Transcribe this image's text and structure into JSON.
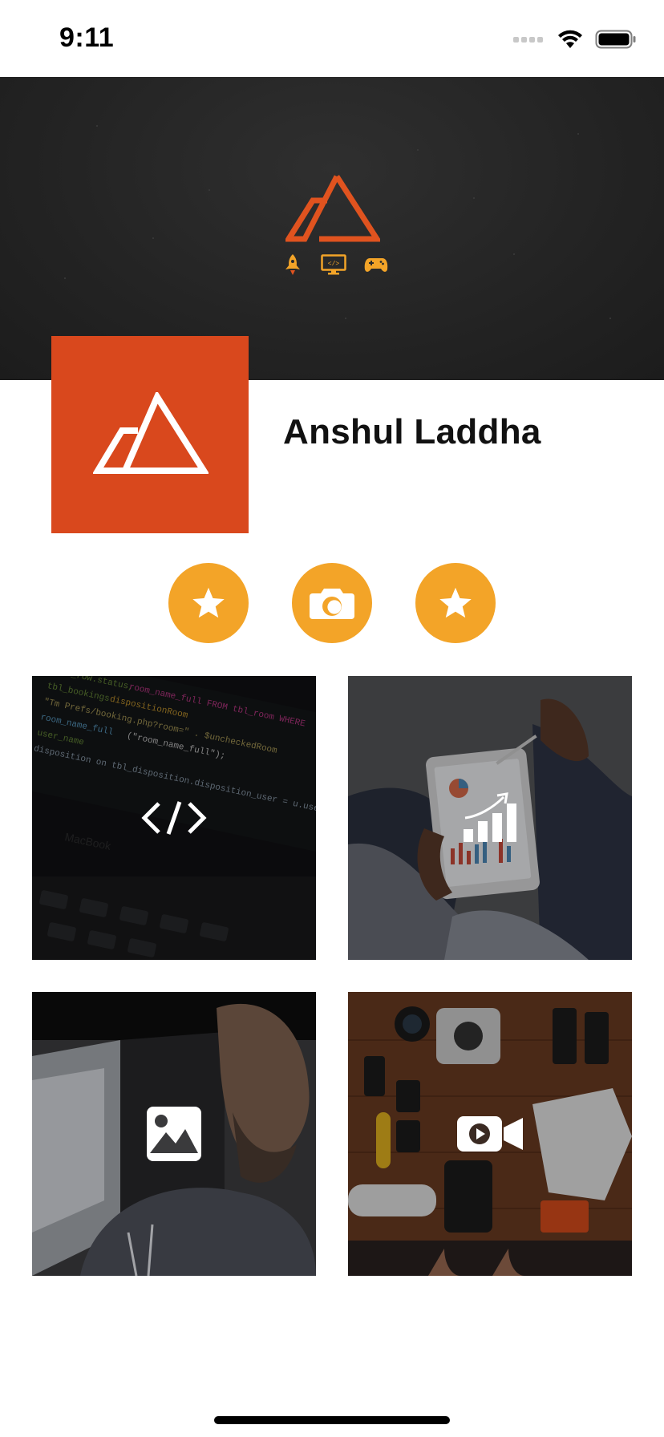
{
  "status_bar": {
    "time": "9:11"
  },
  "header": {
    "cover_icons": [
      "rocket-icon",
      "code-monitor-icon",
      "gamepad-icon"
    ]
  },
  "profile": {
    "name": "Anshul Laddha",
    "avatar_icon": "mountain-logo-icon"
  },
  "actions": [
    {
      "icon": "star-icon"
    },
    {
      "icon": "camera-icon"
    },
    {
      "icon": "star-icon"
    }
  ],
  "tiles": [
    {
      "icon": "code-icon",
      "background": "laptop-code-photo"
    },
    {
      "icon": "bar-chart-icon",
      "background": "tablet-chart-photo"
    },
    {
      "icon": "image-icon",
      "background": "portrait-photo"
    },
    {
      "icon": "video-camera-icon",
      "background": "camera-gear-photo"
    }
  ],
  "colors": {
    "accent_orange": "#f3a428",
    "brand_red": "#d9481d",
    "cover_bg": "#232323",
    "tile_overlay": "rgba(0,0,0,0.45)"
  }
}
